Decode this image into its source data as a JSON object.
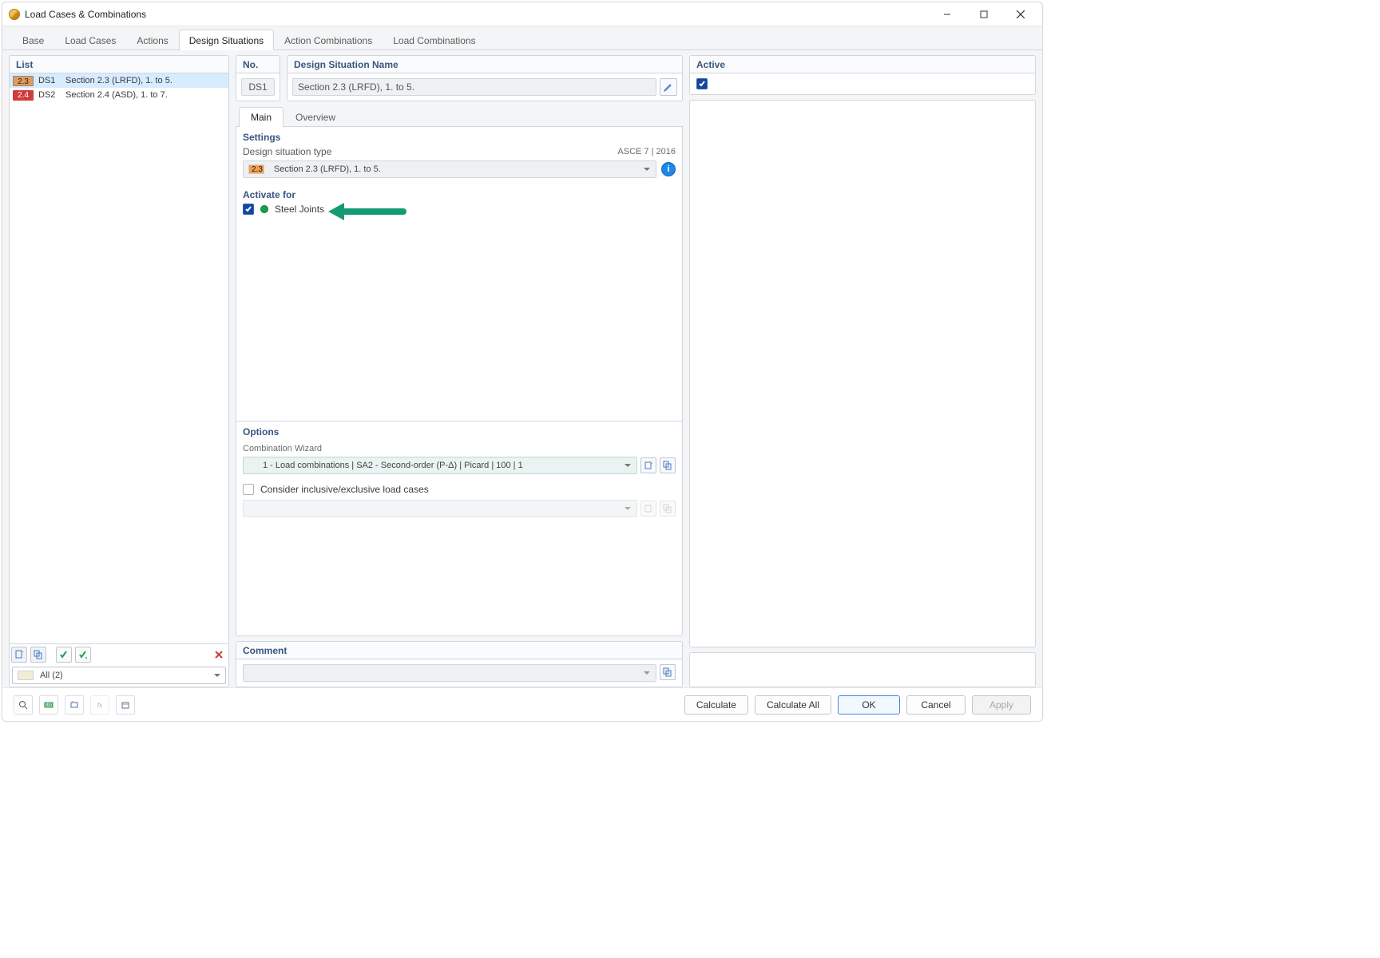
{
  "window": {
    "title": "Load Cases & Combinations"
  },
  "tabs": {
    "base": "Base",
    "load_cases": "Load Cases",
    "actions": "Actions",
    "design": "Design Situations",
    "action_comb": "Action Combinations",
    "load_comb": "Load Combinations"
  },
  "list": {
    "header": "List",
    "items": [
      {
        "badge": "2.3",
        "code": "DS1",
        "label": "Section 2.3 (LRFD), 1. to 5."
      },
      {
        "badge": "2.4",
        "code": "DS2",
        "label": "Section 2.4 (ASD), 1. to 7."
      }
    ],
    "filter": "All (2)"
  },
  "top": {
    "no_header": "No.",
    "no_value": "DS1",
    "name_header": "Design Situation Name",
    "name_value": "Section 2.3 (LRFD), 1. to 5.",
    "active_header": "Active"
  },
  "subtabs": {
    "main": "Main",
    "overview": "Overview"
  },
  "settings": {
    "header": "Settings",
    "type_label": "Design situation type",
    "type_standard": "ASCE 7 | 2016",
    "type_badge": "2.3",
    "type_value": "Section 2.3 (LRFD), 1. to 5."
  },
  "activate": {
    "header": "Activate for",
    "steel_joints": "Steel Joints"
  },
  "options": {
    "header": "Options",
    "wizard_label": "Combination Wizard",
    "wizard_value": "1 - Load combinations | SA2 - Second-order (P-Δ) | Picard | 100 | 1",
    "consider_label": "Consider inclusive/exclusive load cases"
  },
  "comment": {
    "header": "Comment"
  },
  "footer": {
    "calculate": "Calculate",
    "calculate_all": "Calculate All",
    "ok": "OK",
    "cancel": "Cancel",
    "apply": "Apply"
  }
}
